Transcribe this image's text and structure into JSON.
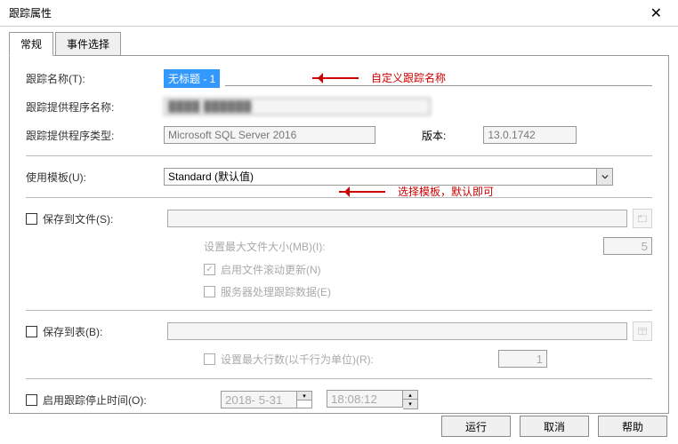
{
  "window": {
    "title": "跟踪属性"
  },
  "tabs": {
    "general": "常规",
    "events": "事件选择"
  },
  "general": {
    "trace_name_label": "跟踪名称(T):",
    "trace_name_value": "无标题 - 1",
    "provider_name_label": "跟踪提供程序名称:",
    "provider_name_value": "████ ██████",
    "provider_type_label": "跟踪提供程序类型:",
    "provider_type_value": "Microsoft SQL Server 2016",
    "version_label": "版本:",
    "version_value": "13.0.1742",
    "template_label": "使用模板(U):",
    "template_value": "Standard (默认值)",
    "save_to_file_label": "保存到文件(S):",
    "max_file_size_label": "设置最大文件大小(MB)(I):",
    "max_file_size_value": "5",
    "enable_rollover_label": "启用文件滚动更新(N)",
    "server_process_label": "服务器处理跟踪数据(E)",
    "save_to_table_label": "保存到表(B):",
    "max_rows_label": "设置最大行数(以千行为单位)(R):",
    "max_rows_value": "1",
    "enable_stop_time_label": "启用跟踪停止时间(O):",
    "stop_date": "2018- 5-31",
    "stop_time": "18:08:12"
  },
  "annotations": {
    "trace_name": "自定义跟踪名称",
    "template": "选择模板，默认即可"
  },
  "buttons": {
    "run": "运行",
    "cancel": "取消",
    "help": "帮助"
  }
}
